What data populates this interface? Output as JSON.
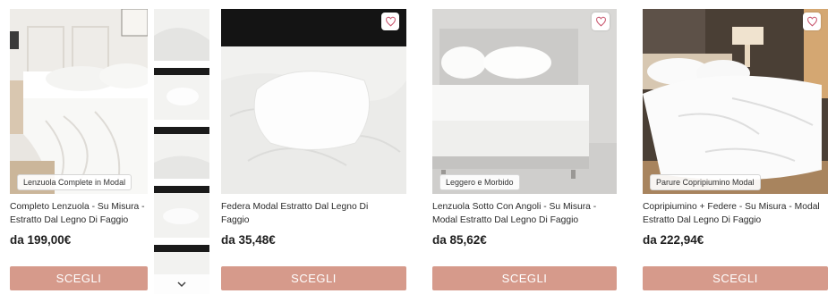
{
  "products": [
    {
      "tag": "Lenzuola Complete in Modal",
      "title": "Completo Lenzuola - Su Misura -\nEstratto Dal Legno Di Faggio",
      "price": "da 199,00€",
      "button": "SCEGLI"
    },
    {
      "tag": "",
      "title": "Federa Modal Estratto Dal Legno Di\nFaggio",
      "price": "da 35,48€",
      "button": "SCEGLI"
    },
    {
      "tag": "Leggero e Morbido",
      "title": "Lenzuola Sotto Con Angoli - Su Misura -\nModal Estratto Dal Legno Di Faggio",
      "price": "da 85,62€",
      "button": "SCEGLI"
    },
    {
      "tag": "Parure Copripiumino Modal",
      "title": "Copripiumino + Federe - Su Misura - Modal\nEstratto Dal Legno Di Faggio",
      "price": "da 222,94€",
      "button": "SCEGLI"
    }
  ],
  "colors": {
    "accent": "#d69a8b",
    "heart": "#c9566e"
  },
  "icons": {
    "wishlist": "heart-icon",
    "gallery_next": "chevron-down-icon"
  }
}
